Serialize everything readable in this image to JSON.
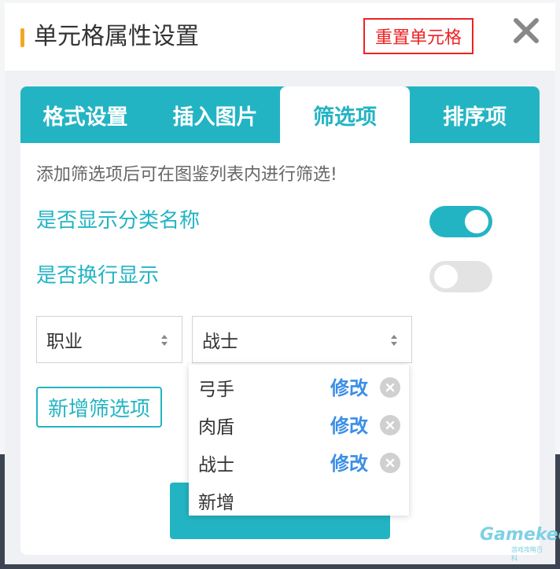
{
  "header": {
    "title": "单元格属性设置",
    "reset_label": "重置单元格"
  },
  "tabs": [
    {
      "label": "格式设置"
    },
    {
      "label": "插入图片"
    },
    {
      "label": "筛选项"
    },
    {
      "label": "排序项"
    }
  ],
  "active_tab": 2,
  "filter": {
    "hint": "添加筛选项后可在图鉴列表内进行筛选!",
    "show_category_name": {
      "label": "是否显示分类名称",
      "on": true
    },
    "wrap_display": {
      "label": "是否换行显示",
      "on": false
    },
    "category_select": {
      "value": "职业"
    },
    "value_select": {
      "value": "战士"
    },
    "add_label": "新增筛选项",
    "options": [
      {
        "label": "弓手",
        "edit": "修改"
      },
      {
        "label": "肉盾",
        "edit": "修改"
      },
      {
        "label": "战士",
        "edit": "修改"
      },
      {
        "label": "新增"
      }
    ]
  },
  "colors": {
    "accent": "#23b4c3",
    "title_bar": "#f5a623",
    "danger": "#e22222",
    "link": "#3b8fe6"
  },
  "watermark": {
    "main": "Gamekee",
    "sub": "游戏攻略百科"
  }
}
